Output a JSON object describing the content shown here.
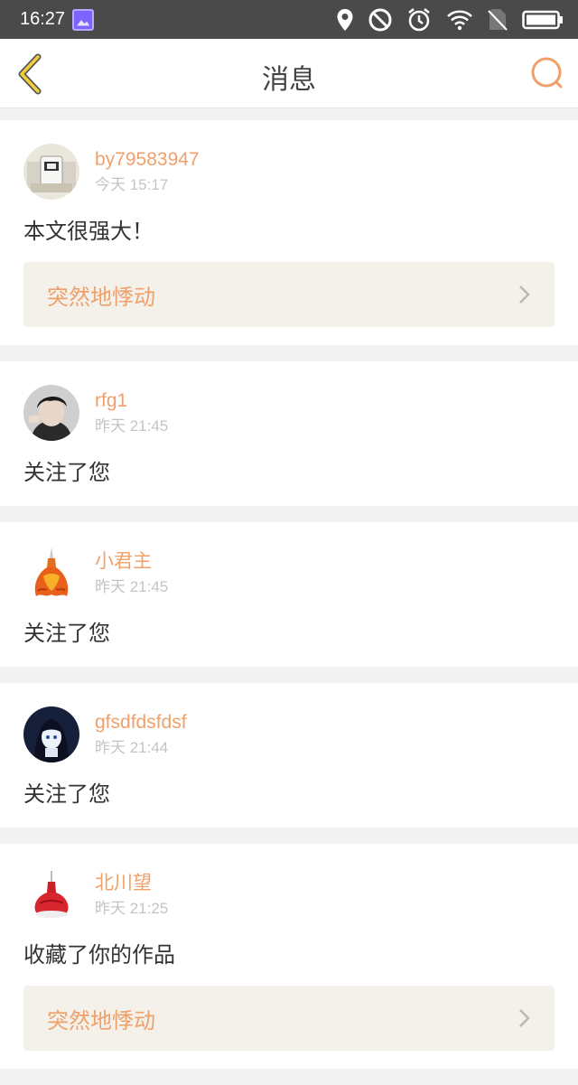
{
  "statusbar": {
    "time": "16:27",
    "icons": [
      "gallery-icon",
      "location-pin-icon",
      "do-not-disturb-icon",
      "alarm-clock-icon",
      "wifi-icon",
      "no-sim-icon",
      "battery-icon"
    ]
  },
  "navbar": {
    "title": "消息",
    "back_icon": "chevron-left-icon",
    "search_icon": "search-icon"
  },
  "colors": {
    "accent": "#f0a06a",
    "back_chevron": "#f2cf3a",
    "time_text": "#c4c4c4",
    "work_bg": "#f3f1ea"
  },
  "messages": [
    {
      "username": "by79583947",
      "time": "今天 15:17",
      "text": "本文很强大！",
      "work": "突然地悸动",
      "avatar": "avatar-photo-cup"
    },
    {
      "username": "rfg1",
      "time": "昨天 21:45",
      "text": "关注了您",
      "avatar": "avatar-photo-boy"
    },
    {
      "username": "小君主",
      "time": "昨天 21:45",
      "text": "关注了您",
      "avatar": "avatar-flame-dress"
    },
    {
      "username": "gfsdfdsfdsf",
      "time": "昨天 21:44",
      "text": "关注了您",
      "avatar": "avatar-anime-girl"
    },
    {
      "username": "北川望",
      "time": "昨天 21:25",
      "text": "收藏了你的作品",
      "work": "突然地悸动",
      "avatar": "avatar-red-dress"
    }
  ]
}
